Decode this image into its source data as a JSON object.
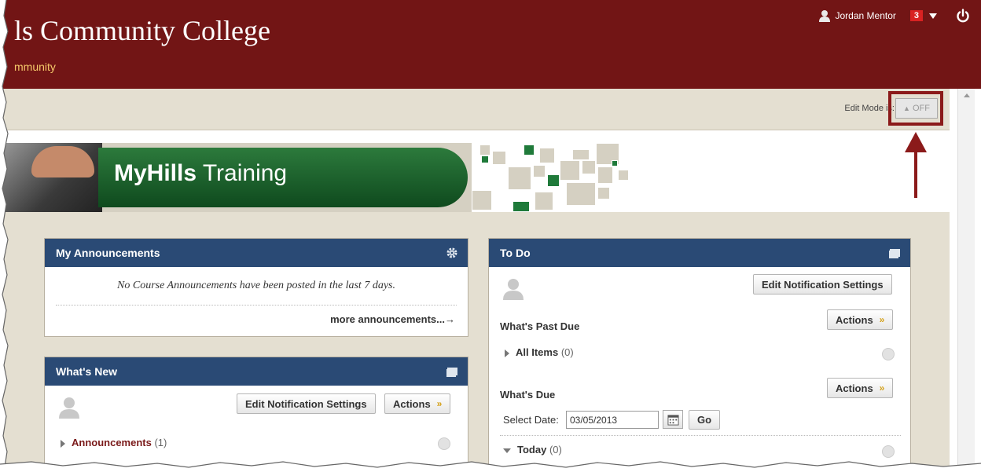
{
  "header": {
    "college_name": "ls Community College",
    "community_link": "mmunity",
    "user_name": "Jordan Mentor",
    "notification_count": "3"
  },
  "edit_mode": {
    "label": "Edit Mode is:",
    "state": "OFF"
  },
  "banner": {
    "brand": "MyHills",
    "title": "Training"
  },
  "announcements": {
    "title": "My Announcements",
    "empty_message": "No Course Announcements have been posted in the last 7 days.",
    "more_link": "more announcements...→"
  },
  "whats_new": {
    "title": "What's New",
    "edit_button": "Edit Notification Settings",
    "actions_button": "Actions",
    "items": [
      {
        "label": "Announcements",
        "count": "(1)"
      }
    ]
  },
  "todo": {
    "title": "To Do",
    "edit_button": "Edit Notification Settings",
    "past_due_title": "What's Past Due",
    "past_due_actions": "Actions",
    "all_items_label": "All Items",
    "all_items_count": "(0)",
    "whats_due_title": "What's Due",
    "whats_due_actions": "Actions",
    "select_date_label": "Select Date:",
    "date_value": "03/05/2013",
    "go_button": "Go",
    "today_label": "Today",
    "today_count": "(0)"
  },
  "colors": {
    "header_bg": "#721515",
    "module_header": "#2a4a75",
    "highlight_red": "#8b1a1a",
    "link_gold": "#f5c96a"
  }
}
